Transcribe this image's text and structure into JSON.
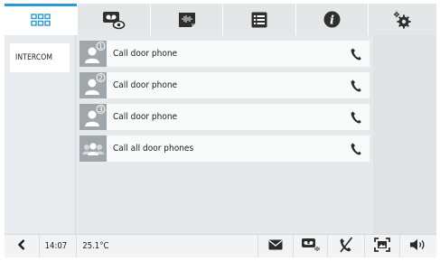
{
  "tabs": [
    {
      "icon": "apps-grid-icon",
      "active": true
    },
    {
      "icon": "answering-machine-icon",
      "active": false
    },
    {
      "icon": "voice-memo-icon",
      "active": false
    },
    {
      "icon": "list-icon",
      "active": false
    },
    {
      "icon": "info-icon",
      "active": false
    },
    {
      "icon": "settings-icon",
      "active": false
    }
  ],
  "sidebar": {
    "selected_item": "INTERCOM"
  },
  "intercom": {
    "items": [
      {
        "label": "Call door phone",
        "badge": "1",
        "icon": "door-phone-user-icon"
      },
      {
        "label": "Call door phone",
        "badge": "2",
        "icon": "door-phone-user-icon"
      },
      {
        "label": "Call door phone",
        "badge": "3",
        "icon": "door-phone-user-icon"
      },
      {
        "label": "Call all door phones",
        "badge": "",
        "icon": "door-phone-group-icon"
      }
    ],
    "action_icon": "phone-handset-icon"
  },
  "status": {
    "time": "14:07",
    "temperature": "25.1°C"
  },
  "bottom_icons": [
    "back-icon",
    "message-icon",
    "voicemail-icon",
    "call-mute-icon",
    "fullscreen-icon",
    "volume-icon"
  ],
  "colors": {
    "accent": "#2b97d3",
    "icon_dark": "#333333",
    "avatar_bg": "#a0a7aa"
  }
}
